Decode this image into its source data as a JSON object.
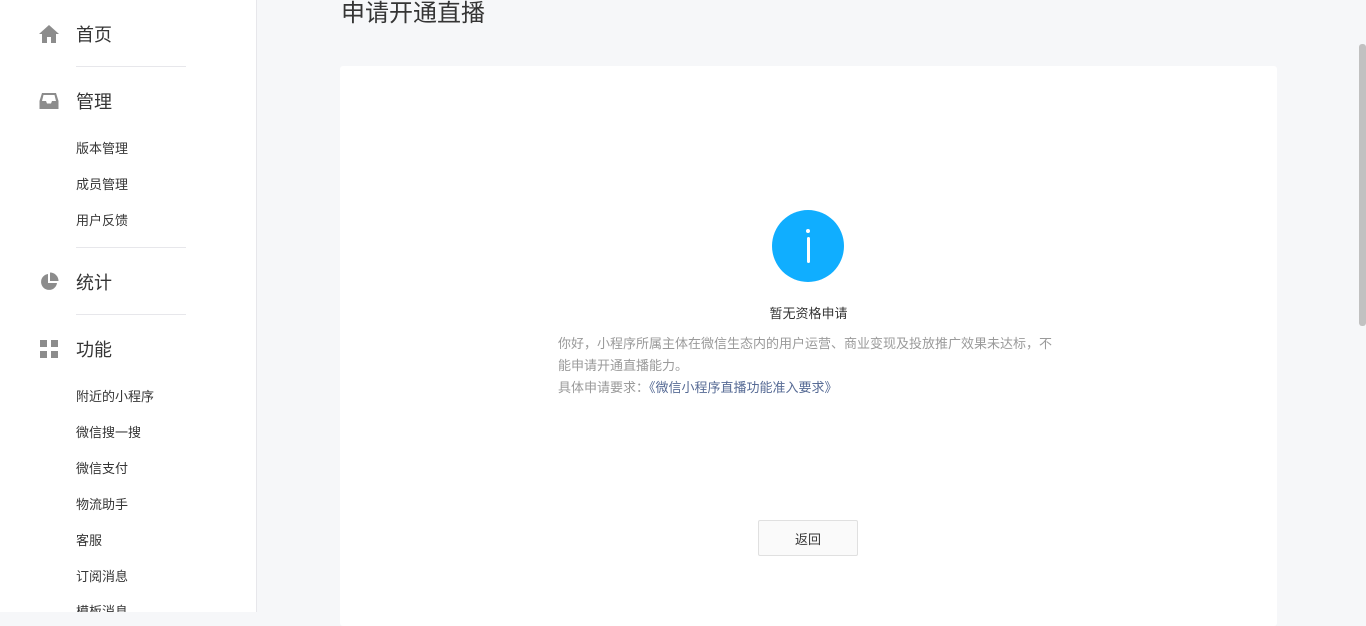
{
  "sidebar": {
    "home": {
      "label": "首页",
      "icon": "home-icon"
    },
    "manage": {
      "label": "管理",
      "icon": "inbox-icon",
      "items": [
        "版本管理",
        "成员管理",
        "用户反馈"
      ]
    },
    "stats": {
      "label": "统计",
      "icon": "pie-chart-icon"
    },
    "features": {
      "label": "功能",
      "icon": "grid-icon",
      "items": [
        "附近的小程序",
        "微信搜一搜",
        "微信支付",
        "物流助手",
        "客服",
        "订阅消息",
        "模板消息"
      ]
    }
  },
  "main": {
    "title": "申请开通直播",
    "status_title": "暂无资格申请",
    "description": "你好，小程序所属主体在微信生态内的用户运营、商业变现及投放推广效果未达标，不能申请开通直播能力。",
    "requirement_prefix": "具体申请要求：",
    "requirement_link": "《微信小程序直播功能准入要求》",
    "back_button": "返回"
  },
  "colors": {
    "info_icon": "#10aeff",
    "link": "#576b95",
    "icon_gray": "#8c8c8c"
  }
}
